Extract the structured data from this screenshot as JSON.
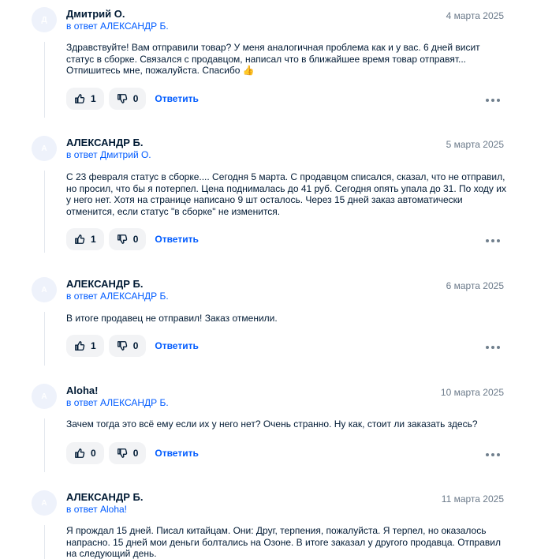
{
  "reply_prefix": "в ответ",
  "reply_button_label": "Ответить",
  "comments": [
    {
      "avatar_letter": "Д",
      "author": "Дмитрий О.",
      "reply_to": "АЛЕКСАНДР Б.",
      "date": "4 марта 2025",
      "text": "Здравствуйте! Вам отправили товар? У меня аналогичная проблема как и у вас. 6 дней висит статус в сборке. Связался с продавцом, написал что в ближайшее время товар отправят... Отпишитесь мне, пожалуйста. Спасибо 👍",
      "likes": "1",
      "dislikes": "0"
    },
    {
      "avatar_letter": "А",
      "author": "АЛЕКСАНДР Б.",
      "reply_to": "Дмитрий О.",
      "date": "5 марта 2025",
      "text": "С 23 февраля статус в сборке.... Сегодня 5 марта. С продавцом списался, сказал, что не отправил, но просил, что бы я потерпел. Цена поднималась до 41 руб. Сегодня опять упала до 31. По ходу их у него нет. Хотя на странице написано 9 шт осталось. Через 15 дней заказ автоматически отменится, если статус \"в сборке\" не изменится.",
      "likes": "1",
      "dislikes": "0"
    },
    {
      "avatar_letter": "А",
      "author": "АЛЕКСАНДР Б.",
      "reply_to": "АЛЕКСАНДР Б.",
      "date": "6 марта 2025",
      "text": "В итоге продавец не отправил! Заказ отменили.",
      "likes": "1",
      "dislikes": "0"
    },
    {
      "avatar_letter": "А",
      "author": "Aloha!",
      "reply_to": "АЛЕКСАНДР Б.",
      "date": "10 марта 2025",
      "text": "Зачем тогда это всё ему если их у него нет? Очень странно. Ну как, стоит ли заказать здесь?",
      "likes": "0",
      "dislikes": "0"
    },
    {
      "avatar_letter": "А",
      "author": "АЛЕКСАНДР Б.",
      "reply_to": "Aloha!",
      "date": "11 марта 2025",
      "text": "Я прождал 15 дней. Писал китайцам. Они: Друг, терпения, пожалуйста. Я терпел, но оказалось напрасно. 15 дней мои деньги болтались на Озоне. В итоге заказал у другого продавца. Отправил на следующий день.",
      "likes": "",
      "dislikes": ""
    }
  ]
}
